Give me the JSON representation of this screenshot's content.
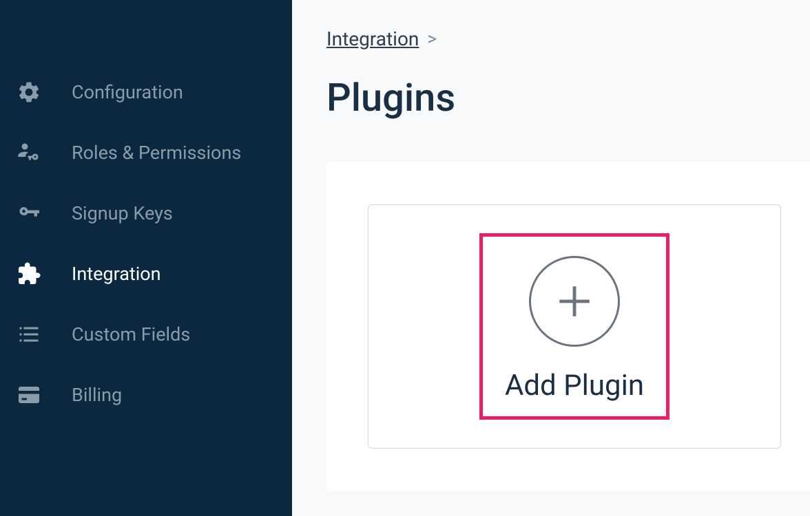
{
  "sidebar": {
    "items": [
      {
        "label": "Configuration",
        "icon": "gear"
      },
      {
        "label": "Roles & Permissions",
        "icon": "user-key"
      },
      {
        "label": "Signup Keys",
        "icon": "key"
      },
      {
        "label": "Integration",
        "icon": "puzzle",
        "active": true
      },
      {
        "label": "Custom Fields",
        "icon": "list"
      },
      {
        "label": "Billing",
        "icon": "credit-card"
      }
    ]
  },
  "breadcrumb": {
    "link": "Integration",
    "separator": ">"
  },
  "page": {
    "title": "Plugins"
  },
  "plugin_card": {
    "label": "Add Plugin"
  }
}
